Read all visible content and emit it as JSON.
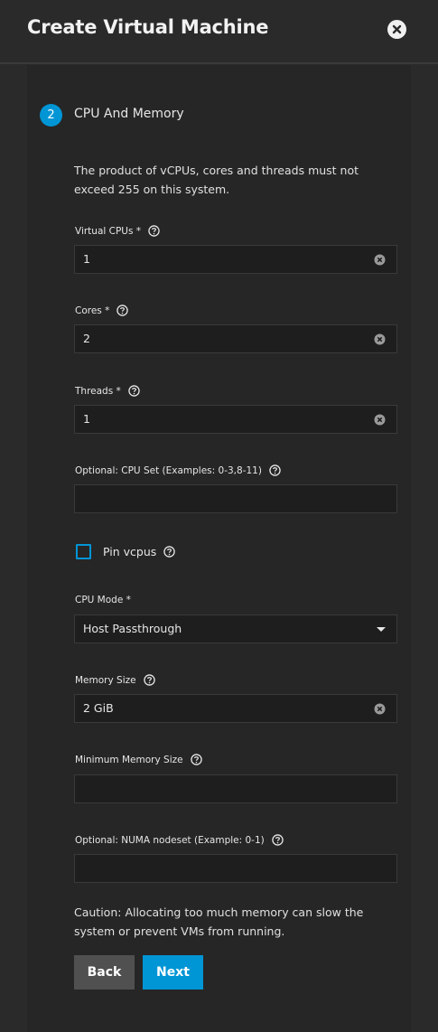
{
  "dialog": {
    "title": "Create Virtual Machine"
  },
  "step": {
    "number": "2",
    "title": "CPU And Memory"
  },
  "info": {
    "text": "The product of vCPUs, cores and threads must not exceed 255 on this system."
  },
  "fields": {
    "vcpus": {
      "label": "Virtual CPUs *",
      "value": "1"
    },
    "cores": {
      "label": "Cores *",
      "value": "2"
    },
    "threads": {
      "label": "Threads *",
      "value": "1"
    },
    "cpuset": {
      "label": "Optional: CPU Set (Examples: 0-3,8-11)",
      "value": ""
    },
    "pin_vcpus": {
      "label": "Pin vcpus",
      "checked": false
    },
    "cpu_mode": {
      "label": "CPU Mode *",
      "value": "Host Passthrough"
    },
    "memory": {
      "label": "Memory Size",
      "value": "2 GiB"
    },
    "min_memory": {
      "label": "Minimum Memory Size",
      "value": ""
    },
    "numa": {
      "label": "Optional: NUMA nodeset (Example: 0-1)",
      "value": ""
    }
  },
  "caution": {
    "text": "Caution: Allocating too much memory can slow the system or prevent VMs from running."
  },
  "buttons": {
    "back": "Back",
    "next": "Next"
  },
  "colors": {
    "accent": "#0095d5",
    "background": "#2a2a2a",
    "field": "#1e1e1e"
  }
}
